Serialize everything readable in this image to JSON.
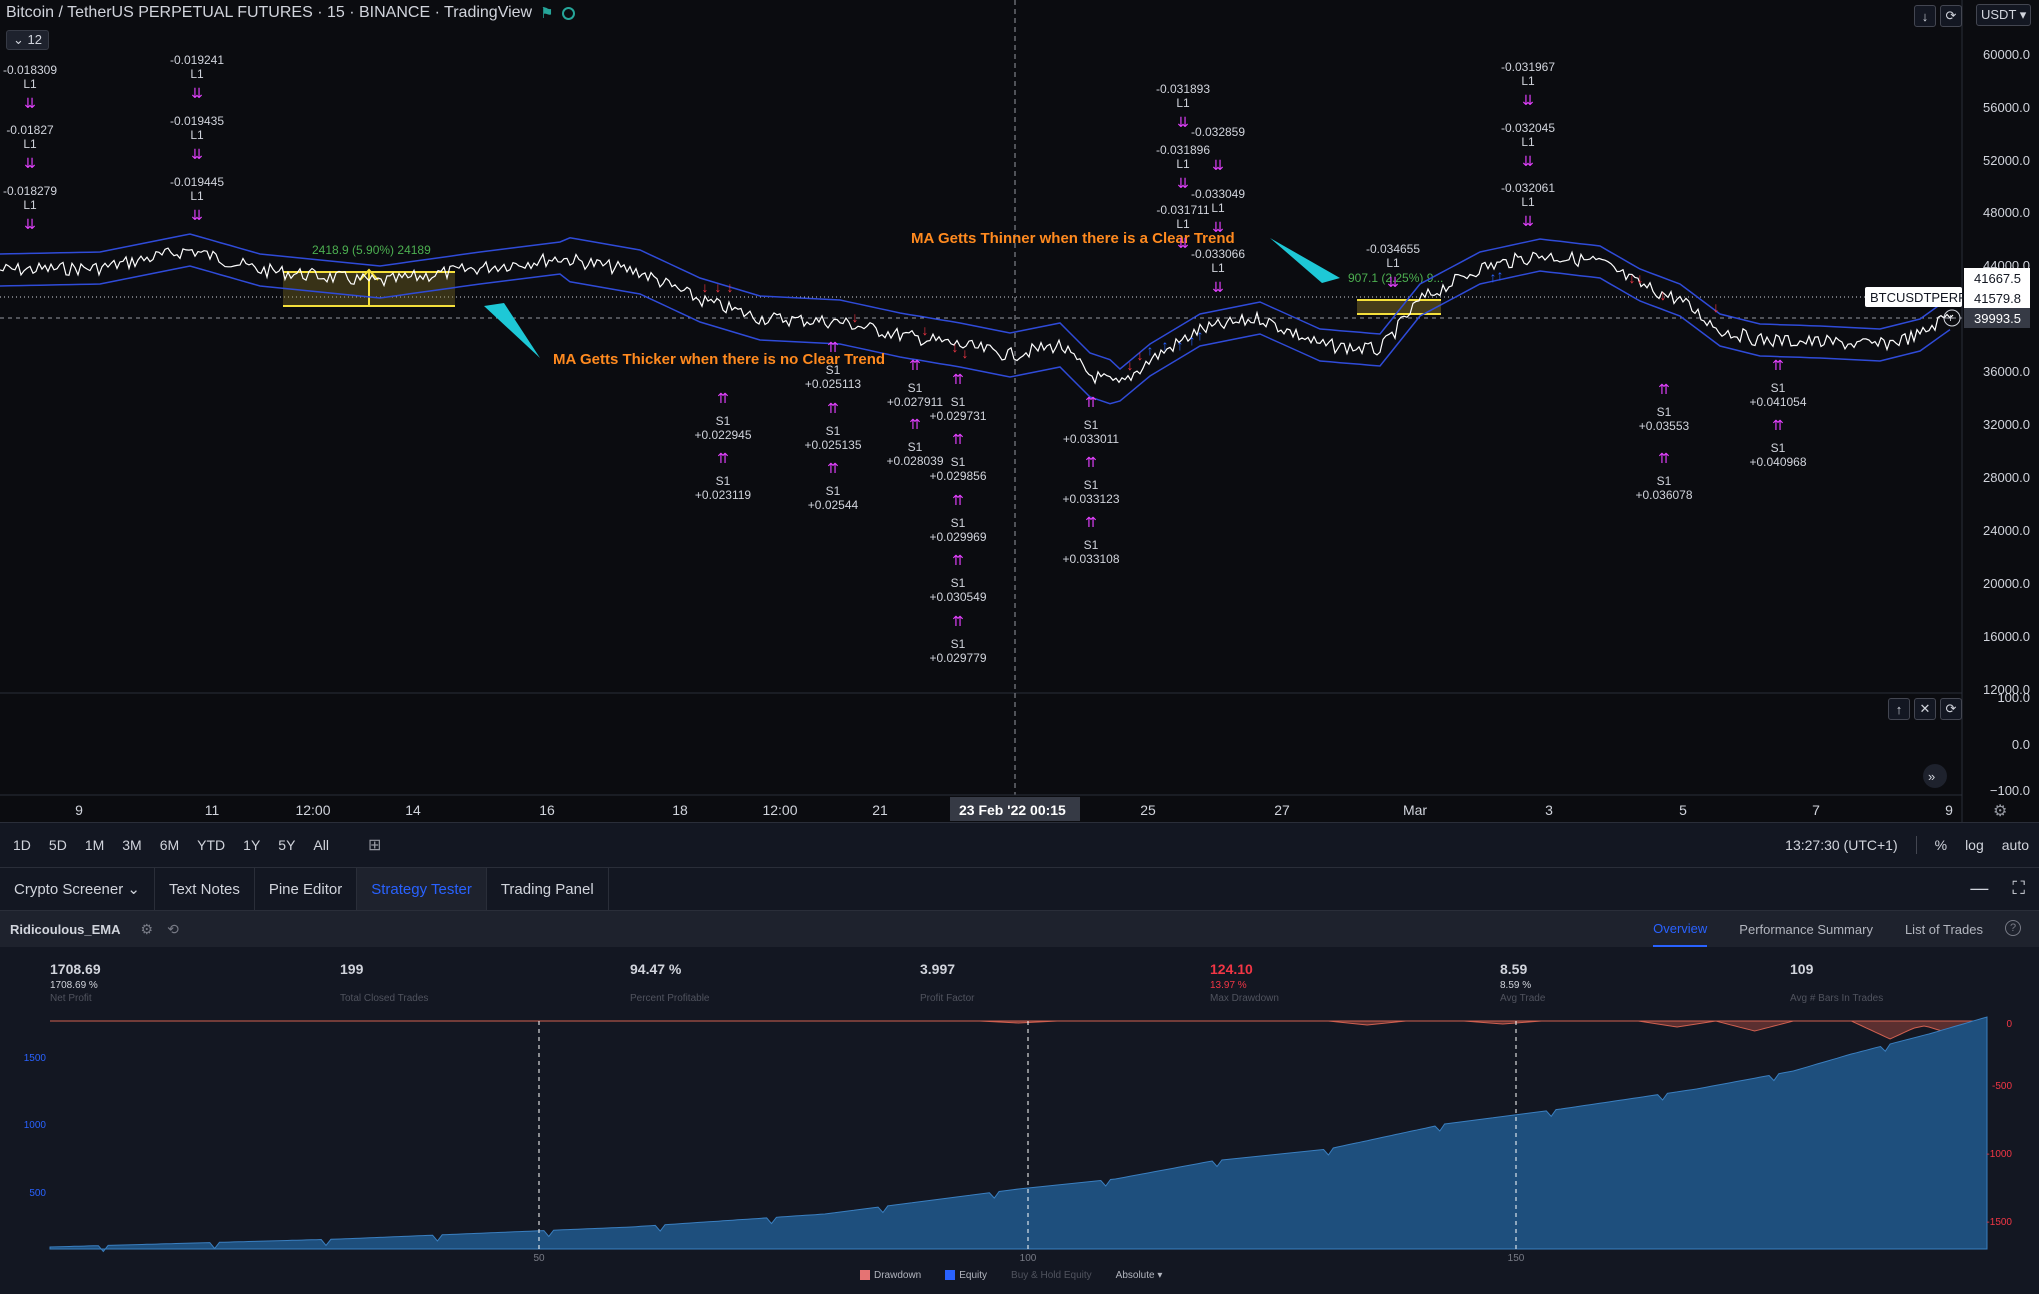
{
  "header": {
    "symbol_line": "Bitcoin / TetherUS PERPETUAL FUTURES · 15 · BINANCE · TradingView",
    "indicator_count": "12",
    "currency": "USDT"
  },
  "price_axis": {
    "labels": [
      "60000.0",
      "56000.0",
      "52000.0",
      "48000.0",
      "44000.0",
      "36000.0",
      "32000.0",
      "28000.0",
      "24000.0",
      "20000.0",
      "16000.0",
      "12000.0"
    ],
    "lower_labels": [
      "100.0",
      "0.0",
      "−100.0"
    ]
  },
  "price_tags": {
    "upper_band": "41667.5",
    "last": "41579.8",
    "crosshair": "39993.5",
    "symbol_tag": "BTCUSDTPERP"
  },
  "time_axis": {
    "labels": [
      "9",
      "11",
      "12:00",
      "14",
      "16",
      "18",
      "12:00",
      "21",
      "25",
      "27",
      "Mar",
      "3",
      "5",
      "7",
      "9"
    ],
    "crosshair": "23 Feb '22  00:15"
  },
  "annotations": {
    "thinner": "MA Getts Thinner when there is a Clear Trend",
    "thicker": "MA Getts Thicker when there is no Clear Trend",
    "measure1": "2418.9 (5.90%) 24189",
    "measure2": "907.1 (2.25%) 9..."
  },
  "trade_labels": {
    "long_top": [
      {
        "v": "-0.018309",
        "t": "L1"
      },
      {
        "v": "-0.01827",
        "t": "L1"
      },
      {
        "v": "-0.018279",
        "t": "L1"
      },
      {
        "v": "-0.019241",
        "t": "L1"
      },
      {
        "v": "-0.019435",
        "t": "L1"
      },
      {
        "v": "-0.019445",
        "t": "L1"
      },
      {
        "v": "-0.031893",
        "t": "L1"
      },
      {
        "v": "-0.031896",
        "t": "L1"
      },
      {
        "v": "-0.031711",
        "t": "L1"
      },
      {
        "v": "-0.032859",
        "t": ""
      },
      {
        "v": "-0.033049",
        "t": "L1"
      },
      {
        "v": "-0.033066",
        "t": "L1"
      },
      {
        "v": "-0.031967",
        "t": "L1"
      },
      {
        "v": "-0.032045",
        "t": "L1"
      },
      {
        "v": "-0.032061",
        "t": "L1"
      },
      {
        "v": "-0.034655",
        "t": "L1"
      }
    ],
    "short_bottom": [
      {
        "t": "S1",
        "v": "+0.022945"
      },
      {
        "t": "S1",
        "v": "+0.023119"
      },
      {
        "t": "S1",
        "v": "+0.025113"
      },
      {
        "t": "S1",
        "v": "+0.025135"
      },
      {
        "t": "S1",
        "v": "+0.02544"
      },
      {
        "t": "S1",
        "v": "+0.027911"
      },
      {
        "t": "S1",
        "v": "+0.028039"
      },
      {
        "t": "S1",
        "v": "+0.029731"
      },
      {
        "t": "S1",
        "v": "+0.029856"
      },
      {
        "t": "S1",
        "v": "+0.029969"
      },
      {
        "t": "S1",
        "v": "+0.030549"
      },
      {
        "t": "S1",
        "v": "+0.029779"
      },
      {
        "t": "S1",
        "v": "+0.033011"
      },
      {
        "t": "S1",
        "v": "+0.033123"
      },
      {
        "t": "S1",
        "v": "+0.033108"
      },
      {
        "t": "S1",
        "v": "+0.03553"
      },
      {
        "t": "S1",
        "v": "+0.036078"
      },
      {
        "t": "S1",
        "v": "+0.041054"
      },
      {
        "t": "S1",
        "v": "+0.040968"
      }
    ]
  },
  "timeframes": [
    "1D",
    "5D",
    "1M",
    "3M",
    "6M",
    "YTD",
    "1Y",
    "5Y",
    "All"
  ],
  "status": {
    "clock": "13:27:30 (UTC+1)",
    "percent": "%",
    "log": "log",
    "auto": "auto"
  },
  "panel_tabs": [
    "Crypto Screener",
    "Text Notes",
    "Pine Editor",
    "Strategy Tester",
    "Trading Panel"
  ],
  "strategy": {
    "name": "Ridicoulous_EMA",
    "tabs": [
      "Overview",
      "Performance Summary",
      "List of Trades"
    ]
  },
  "metrics": [
    {
      "value": "1708.69",
      "sub": "1708.69 %",
      "label": "Net Profit",
      "neg": false
    },
    {
      "value": "199",
      "sub": "",
      "label": "Total Closed Trades",
      "neg": false
    },
    {
      "value": "94.47 %",
      "sub": "",
      "label": "Percent Profitable",
      "neg": false
    },
    {
      "value": "3.997",
      "sub": "",
      "label": "Profit Factor",
      "neg": false
    },
    {
      "value": "124.10",
      "sub": "13.97 %",
      "label": "Max Drawdown",
      "neg": true
    },
    {
      "value": "8.59",
      "sub": "8.59 %",
      "label": "Avg Trade",
      "neg": false
    },
    {
      "value": "109",
      "sub": "",
      "label": "Avg # Bars In Trades",
      "neg": false
    }
  ],
  "equity_chart": {
    "left_axis": [
      "1500",
      "1000",
      "500"
    ],
    "right_axis": [
      "0",
      "-500",
      "-1000",
      "-1500"
    ],
    "x_ticks": [
      "50",
      "100",
      "150"
    ],
    "legend": [
      "Drawdown",
      "Equity",
      "Buy & Hold Equity",
      "Absolute"
    ],
    "colors": {
      "equity": "#1e4f7d",
      "drawdown": "#7a3a36",
      "accent": "#2962ff"
    }
  }
}
